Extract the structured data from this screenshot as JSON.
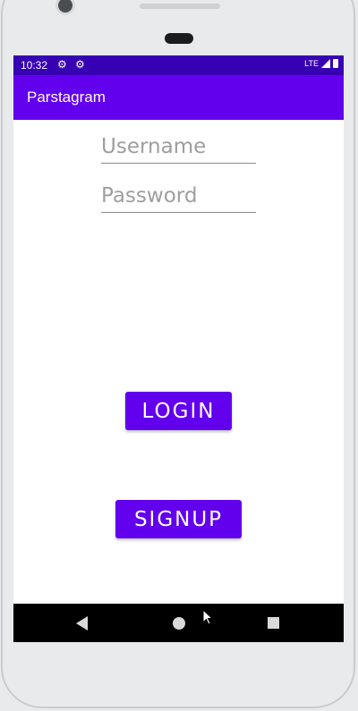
{
  "status_bar": {
    "time": "10:32",
    "left_icons": [
      "gear-icon",
      "gear-icon"
    ],
    "network": "LTE",
    "colors": {
      "background": "#3700b3"
    }
  },
  "app_bar": {
    "title": "Parstagram",
    "color": "#6200ee"
  },
  "form": {
    "username": {
      "placeholder": "Username",
      "value": ""
    },
    "password": {
      "placeholder": "Password",
      "value": ""
    }
  },
  "buttons": {
    "login_label": "LOGIN",
    "signup_label": "SIGNUP",
    "color": "#6200ee"
  },
  "nav_bar": {
    "icons": [
      "back-icon",
      "home-icon",
      "recents-icon"
    ]
  }
}
